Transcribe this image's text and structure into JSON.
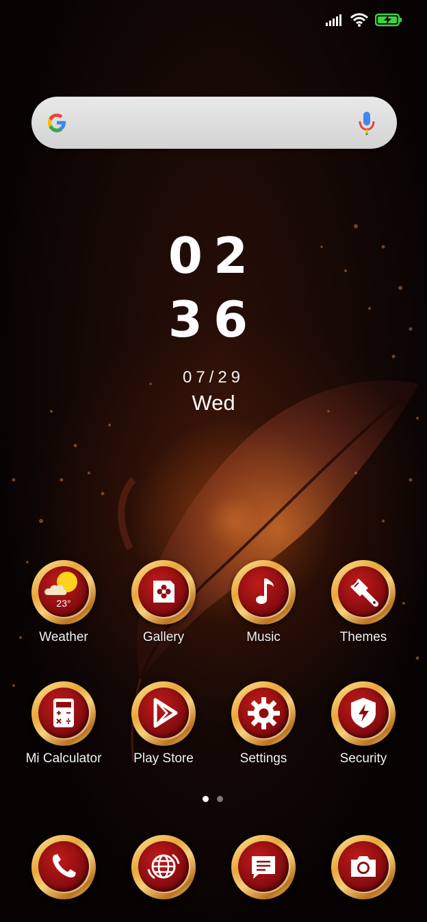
{
  "status_bar": {
    "icons": [
      "signal-icon",
      "wifi-icon",
      "battery-charging-icon"
    ]
  },
  "search": {
    "placeholder": "",
    "left_icon": "google-g-icon",
    "right_icon": "mic-icon"
  },
  "clock": {
    "hours": "02",
    "minutes": "36",
    "date": "07/29",
    "day": "Wed"
  },
  "apps_row1": [
    {
      "label": "Weather",
      "icon": "weather-icon",
      "temp": "23°"
    },
    {
      "label": "Gallery",
      "icon": "gallery-icon"
    },
    {
      "label": "Music",
      "icon": "music-note-icon"
    },
    {
      "label": "Themes",
      "icon": "paint-brush-icon"
    }
  ],
  "apps_row2": [
    {
      "label": "Mi Calculator",
      "icon": "calculator-icon"
    },
    {
      "label": "Play Store",
      "icon": "play-store-icon"
    },
    {
      "label": "Settings",
      "icon": "gear-icon"
    },
    {
      "label": "Security",
      "icon": "shield-lightning-icon"
    }
  ],
  "dock": [
    {
      "icon": "phone-icon"
    },
    {
      "icon": "browser-globe-icon"
    },
    {
      "icon": "messages-icon"
    },
    {
      "icon": "camera-icon"
    }
  ],
  "page_indicator": {
    "total": 2,
    "current": 1
  },
  "colors": {
    "icon_inner": "#8d0d10",
    "icon_ring": "#e9a63a",
    "wallpaper_glow": "#ff9628"
  }
}
